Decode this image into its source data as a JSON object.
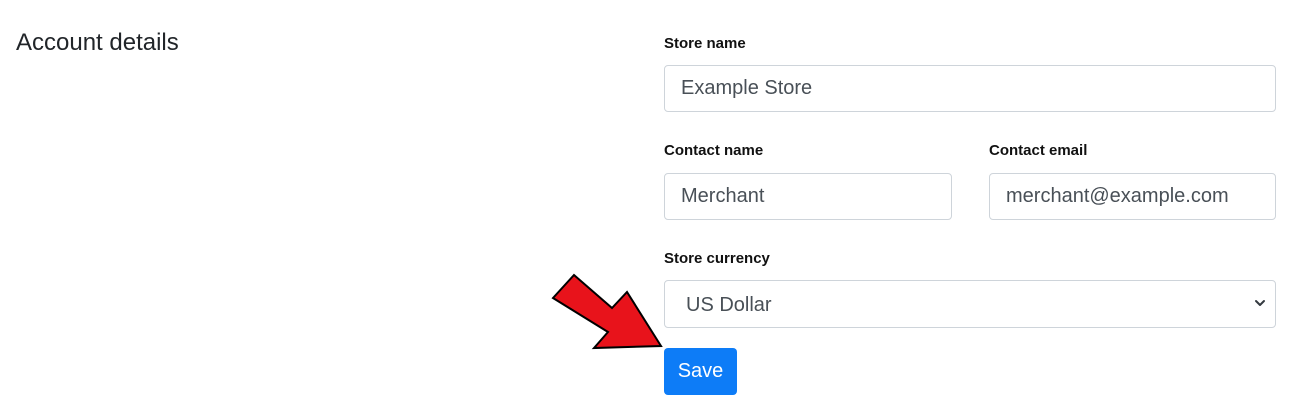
{
  "section": {
    "title": "Account details"
  },
  "form": {
    "store_name": {
      "label": "Store name",
      "value": "Example Store"
    },
    "contact_name": {
      "label": "Contact name",
      "value": "Merchant"
    },
    "contact_email": {
      "label": "Contact email",
      "value": "merchant@example.com"
    },
    "store_currency": {
      "label": "Store currency",
      "selected": "US Dollar"
    },
    "save_label": "Save"
  },
  "annotation": {
    "icon": "arrow-pointer-icon",
    "color": "#e8131b"
  },
  "colors": {
    "primary": "#0d7cf7",
    "border": "#ced4da"
  }
}
